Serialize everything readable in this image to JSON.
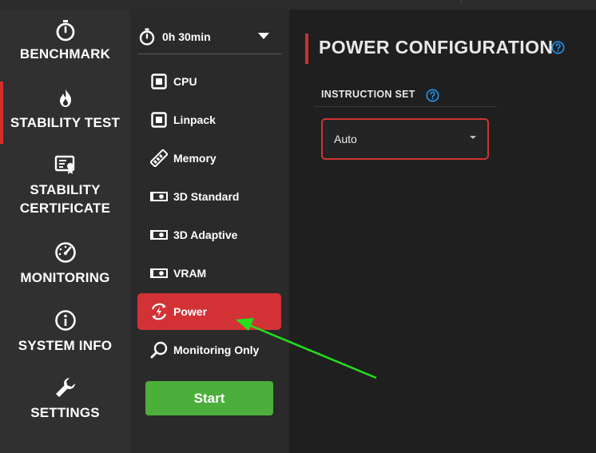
{
  "nav": {
    "items": [
      {
        "label": "BENCHMARK",
        "icon": "stopwatch-icon"
      },
      {
        "label": "STABILITY TEST",
        "icon": "flame-icon"
      },
      {
        "label_line1": "STABILITY",
        "label_line2": "CERTIFICATE",
        "icon": "certificate-icon"
      },
      {
        "label": "MONITORING",
        "icon": "gauge-icon"
      },
      {
        "label": "SYSTEM INFO",
        "icon": "info-icon"
      },
      {
        "label": "SETTINGS",
        "icon": "wrench-icon"
      }
    ],
    "active": "STABILITY TEST"
  },
  "duration": {
    "value": "0h 30min"
  },
  "tests": [
    {
      "label": "CPU",
      "icon": "chip-icon"
    },
    {
      "label": "Linpack",
      "icon": "chip-icon"
    },
    {
      "label": "Memory",
      "icon": "ram-icon"
    },
    {
      "label": "3D Standard",
      "icon": "gpu-icon"
    },
    {
      "label": "3D Adaptive",
      "icon": "gpu-icon"
    },
    {
      "label": "VRAM",
      "icon": "gpu-icon"
    },
    {
      "label": "Power",
      "icon": "power-cycle-icon"
    },
    {
      "label": "Monitoring Only",
      "icon": "magnifier-icon"
    }
  ],
  "active_test": "Power",
  "start": {
    "label": "Start"
  },
  "config": {
    "title": "POWER CONFIGURATION",
    "instruction_set_label": "INSTRUCTION SET",
    "instruction_set_value": "Auto"
  },
  "colors": {
    "accent_red": "#d23236",
    "start_green": "#4caf3c",
    "help_blue": "#2196f3",
    "annotation_arrow": "#22e01b"
  }
}
